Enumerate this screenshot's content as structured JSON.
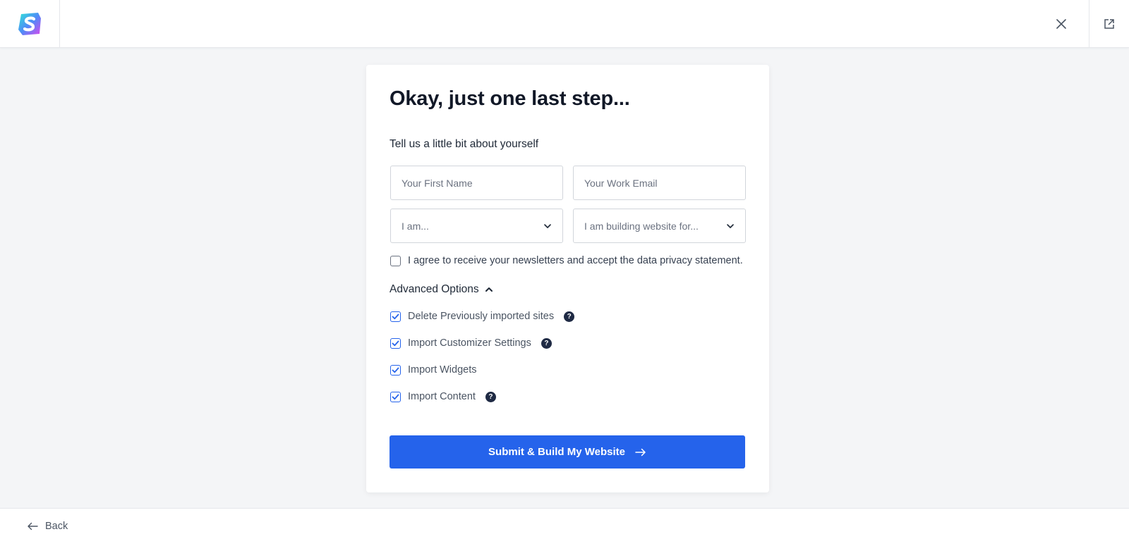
{
  "header": {
    "logo_icon": "starter-templates-logo-icon",
    "close_icon": "close-icon",
    "external_icon": "external-link-icon"
  },
  "form": {
    "title": "Okay, just one last step...",
    "subtitle": "Tell us a little bit about yourself",
    "first_name_placeholder": "Your First Name",
    "email_placeholder": "Your Work Email",
    "role_select_value": "I am...",
    "purpose_select_value": "I am building website for...",
    "agree_label": "I agree to receive your newsletters and accept the data privacy statement.",
    "agree_checked": false,
    "advanced_label": "Advanced Options",
    "options": [
      {
        "label": "Delete Previously imported sites",
        "checked": true,
        "help": true
      },
      {
        "label": "Import Customizer Settings",
        "checked": true,
        "help": true
      },
      {
        "label": "Import Widgets",
        "checked": true,
        "help": false
      },
      {
        "label": "Import Content",
        "checked": true,
        "help": true
      }
    ],
    "help_glyph": "?",
    "submit_label": "Submit & Build My Website"
  },
  "footer": {
    "back_label": "Back"
  },
  "colors": {
    "accent": "#2563eb",
    "background": "#f4f5f7",
    "help_badge": "#1f2a44"
  }
}
